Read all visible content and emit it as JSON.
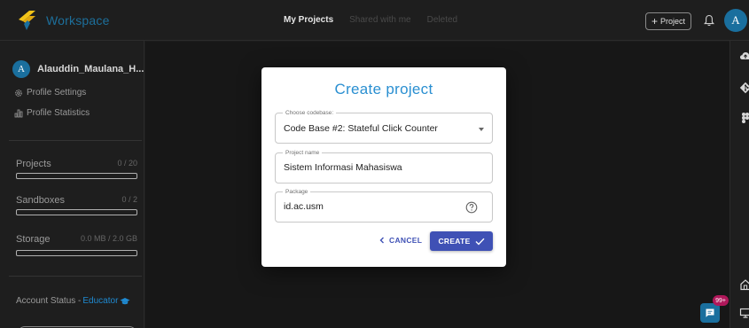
{
  "topbar": {
    "brand": "Workspace",
    "tabs": [
      {
        "label": "My Projects",
        "active": true
      },
      {
        "label": "Shared with me",
        "active": false
      },
      {
        "label": "Deleted",
        "active": false
      }
    ],
    "project_button": "Project",
    "avatar_initial": "A"
  },
  "sidebar": {
    "avatar_initial": "A",
    "username": "Alauddin_Maulana_H...",
    "links": [
      {
        "label": "Profile Settings",
        "icon": "gear-icon"
      },
      {
        "label": "Profile Statistics",
        "icon": "bar-chart-icon"
      }
    ],
    "metrics": [
      {
        "label": "Projects",
        "value": "0 / 20",
        "fraction": 0
      },
      {
        "label": "Sandboxes",
        "value": "0 / 2",
        "fraction": 0
      },
      {
        "label": "Storage",
        "value": "0.0 MB / 2.0 GB",
        "fraction": 0
      }
    ],
    "status_label": "Account Status -",
    "status_value": "Educator"
  },
  "chat": {
    "badge": "99+"
  },
  "dialog": {
    "title": "Create project",
    "codebase": {
      "label": "Choose codebase:",
      "value": "Code Base #2: Stateful Click Counter"
    },
    "project_name": {
      "label": "Project name",
      "value": "Sistem Informasi Mahasiswa"
    },
    "package": {
      "label": "Package",
      "value": "id.ac.usm"
    },
    "cancel_label": "CANCEL",
    "create_label": "CREATE"
  },
  "colors": {
    "accent": "#3f51b5",
    "brand": "#1a6f9e",
    "title": "#2a8fd1",
    "educator": "#1f8ad1",
    "badge": "#b0175a"
  }
}
